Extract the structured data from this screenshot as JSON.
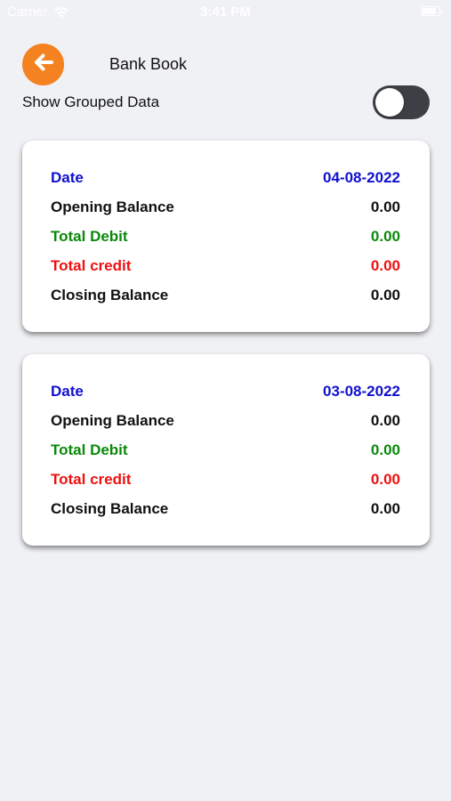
{
  "status_bar": {
    "carrier": "Carrier",
    "time": "3:41 PM",
    "wifi_icon": "wifi-icon",
    "battery_icon": "battery-icon"
  },
  "header": {
    "back_icon": "arrow-left-icon",
    "title": "Bank Book"
  },
  "grouped": {
    "label": "Show Grouped Data",
    "enabled": false
  },
  "colors": {
    "accent": "#f58220",
    "date": "#1010d0",
    "debit": "#0a8a0a",
    "credit": "#ee1111",
    "text": "#111111",
    "background": "#f0f1f4",
    "toggle_off": "#3e3f44"
  },
  "cards": [
    {
      "date_label": "Date",
      "date": "04-08-2022",
      "opening_label": "Opening Balance",
      "opening": "0.00",
      "debit_label": "Total Debit",
      "debit": "0.00",
      "credit_label": "Total credit",
      "credit": "0.00",
      "closing_label": "Closing Balance",
      "closing": "0.00"
    },
    {
      "date_label": "Date",
      "date": "03-08-2022",
      "opening_label": "Opening Balance",
      "opening": "0.00",
      "debit_label": "Total Debit",
      "debit": "0.00",
      "credit_label": "Total credit",
      "credit": "0.00",
      "closing_label": "Closing Balance",
      "closing": "0.00"
    }
  ]
}
